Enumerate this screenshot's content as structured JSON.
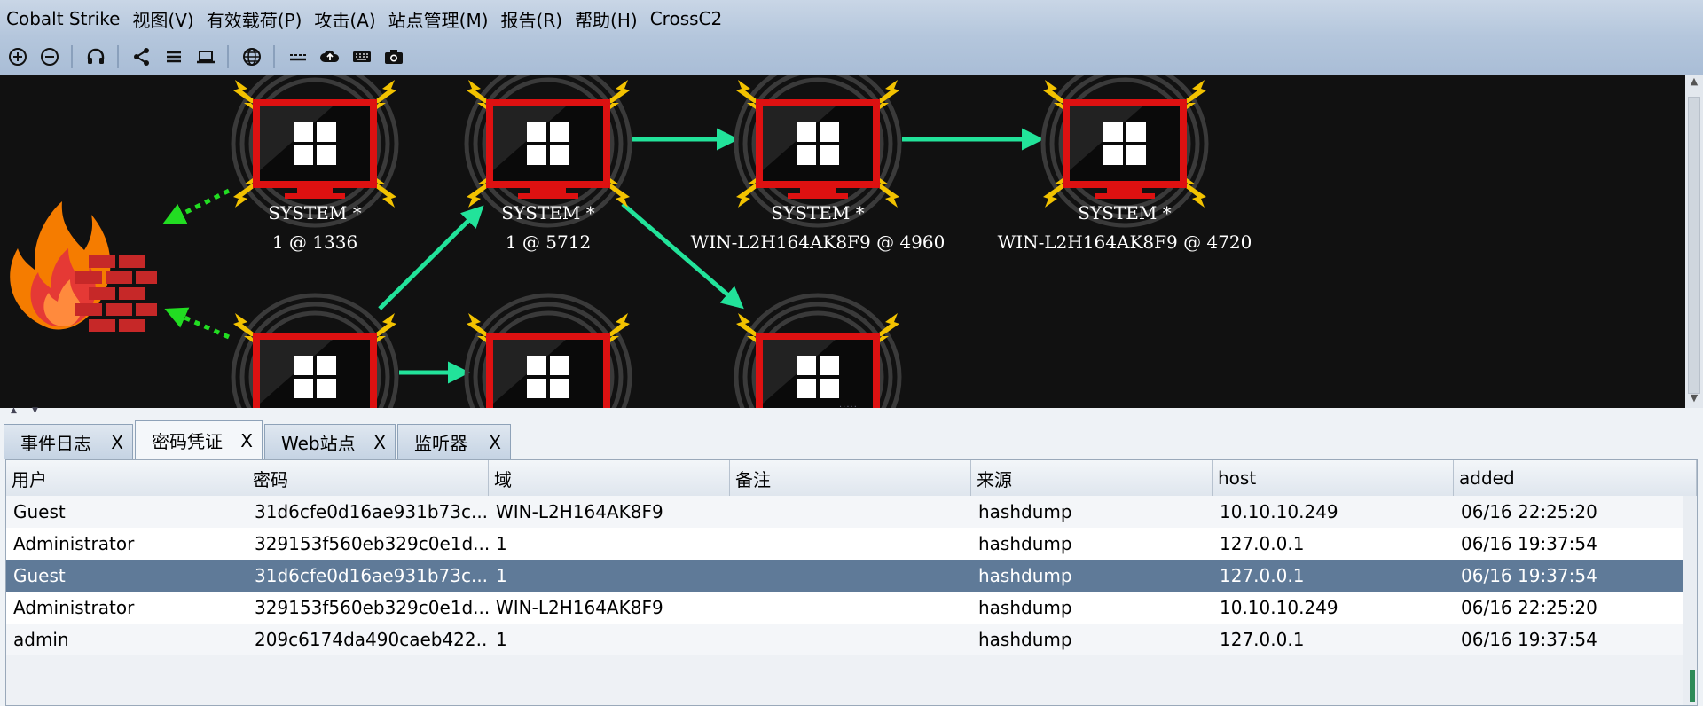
{
  "menu": [
    "Cobalt Strike",
    "视图(V)",
    "有效载荷(P)",
    "攻击(A)",
    "站点管理(M)",
    "报告(R)",
    "帮助(H)",
    "CrossC2"
  ],
  "toolbar": [
    "plus-circle-icon",
    "minus-circle-icon",
    "headset-icon",
    "share-icon",
    "list-icon",
    "laptop-icon",
    "globe-icon",
    "keyboard-dots-icon",
    "cloud-upload-icon",
    "keyboard-icon",
    "camera-icon"
  ],
  "graph": {
    "nodes": [
      {
        "label1": "SYSTEM *",
        "label2": "1 @ 1336"
      },
      {
        "label1": "SYSTEM *",
        "label2": "1 @ 5712"
      },
      {
        "label1": "SYSTEM *",
        "label2": "WIN-L2H164AK8F9 @ 4960"
      },
      {
        "label1": "SYSTEM *",
        "label2": "WIN-L2H164AK8F9 @ 4720"
      }
    ],
    "colors": {
      "arrow": "#22e39a",
      "dotted": "#22dd22",
      "screen_border": "#dd1111",
      "bolt": "#f2c200"
    }
  },
  "tabs": [
    {
      "label": "事件日志",
      "close": "X"
    },
    {
      "label": "密码凭证",
      "close": "X"
    },
    {
      "label": "Web站点",
      "close": "X"
    },
    {
      "label": "监听器",
      "close": "X"
    }
  ],
  "table": {
    "headers": [
      "用户",
      "密码",
      "域",
      "备注",
      "来源",
      "host",
      "added"
    ],
    "rows": [
      [
        "Guest",
        "31d6cfe0d16ae931b73c...",
        "WIN-L2H164AK8F9",
        "",
        "hashdump",
        "10.10.10.249",
        "06/16 22:25:20"
      ],
      [
        "Administrator",
        "329153f560eb329c0e1d...",
        "1",
        "",
        "hashdump",
        "127.0.0.1",
        "06/16 19:37:54"
      ],
      [
        "Guest",
        "31d6cfe0d16ae931b73c...",
        "1",
        "",
        "hashdump",
        "127.0.0.1",
        "06/16 19:37:54"
      ],
      [
        "Administrator",
        "329153f560eb329c0e1d...",
        "WIN-L2H164AK8F9",
        "",
        "hashdump",
        "10.10.10.249",
        "06/16 22:25:20"
      ],
      [
        "admin",
        "209c6174da490caeb422...",
        "1",
        "",
        "hashdump",
        "127.0.0.1",
        "06/16 19:37:54"
      ]
    ]
  }
}
